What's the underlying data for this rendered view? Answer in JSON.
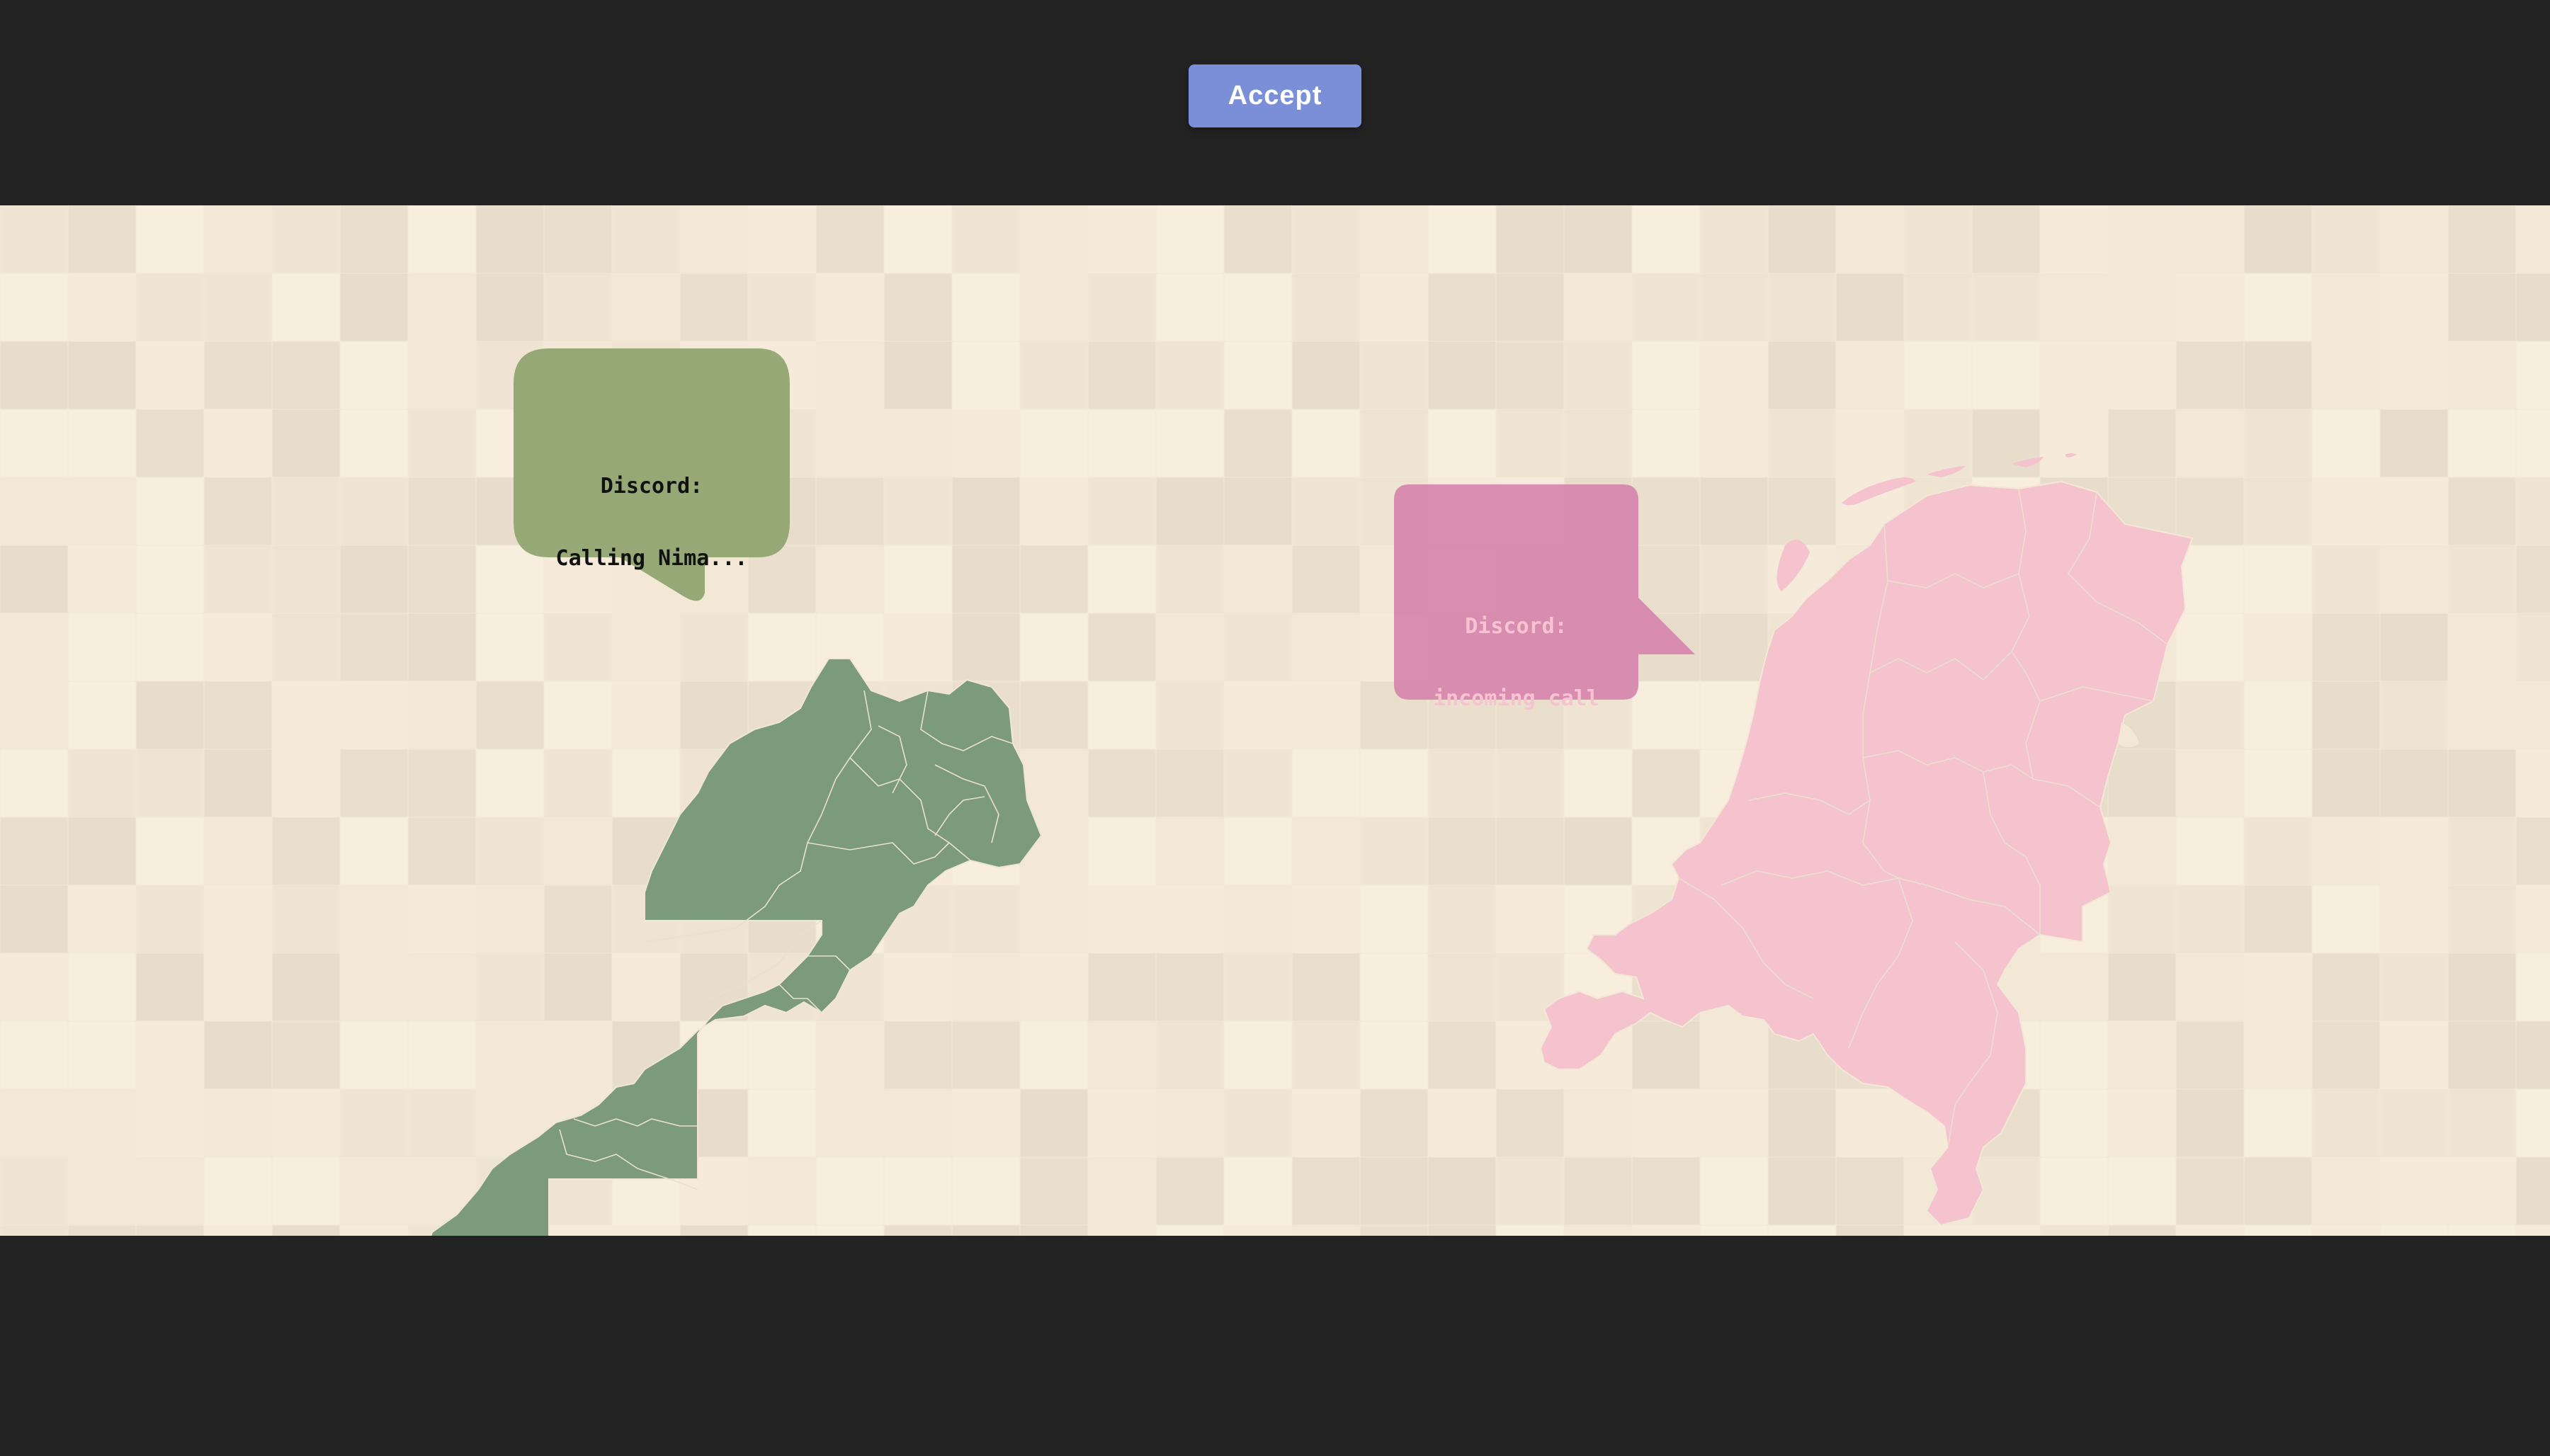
{
  "toolbar": {
    "accept_label": "Accept"
  },
  "bubbles": {
    "left": {
      "line1": "Discord:",
      "line2": "Calling Nima..."
    },
    "right": {
      "line1": "Discord:",
      "line2": "incoming call"
    }
  },
  "colors": {
    "background_dark": "#232323",
    "accept_button": "#7b8ed8",
    "left_map": "#7b9b7a",
    "left_bubble": "#8ea36e",
    "right_map": "#f5c3cd",
    "right_bubble": "#d684ad",
    "tile_base": "#f3e7d6"
  },
  "icons": {
    "left_map": "morocco-map-icon",
    "right_map": "netherlands-map-icon"
  }
}
